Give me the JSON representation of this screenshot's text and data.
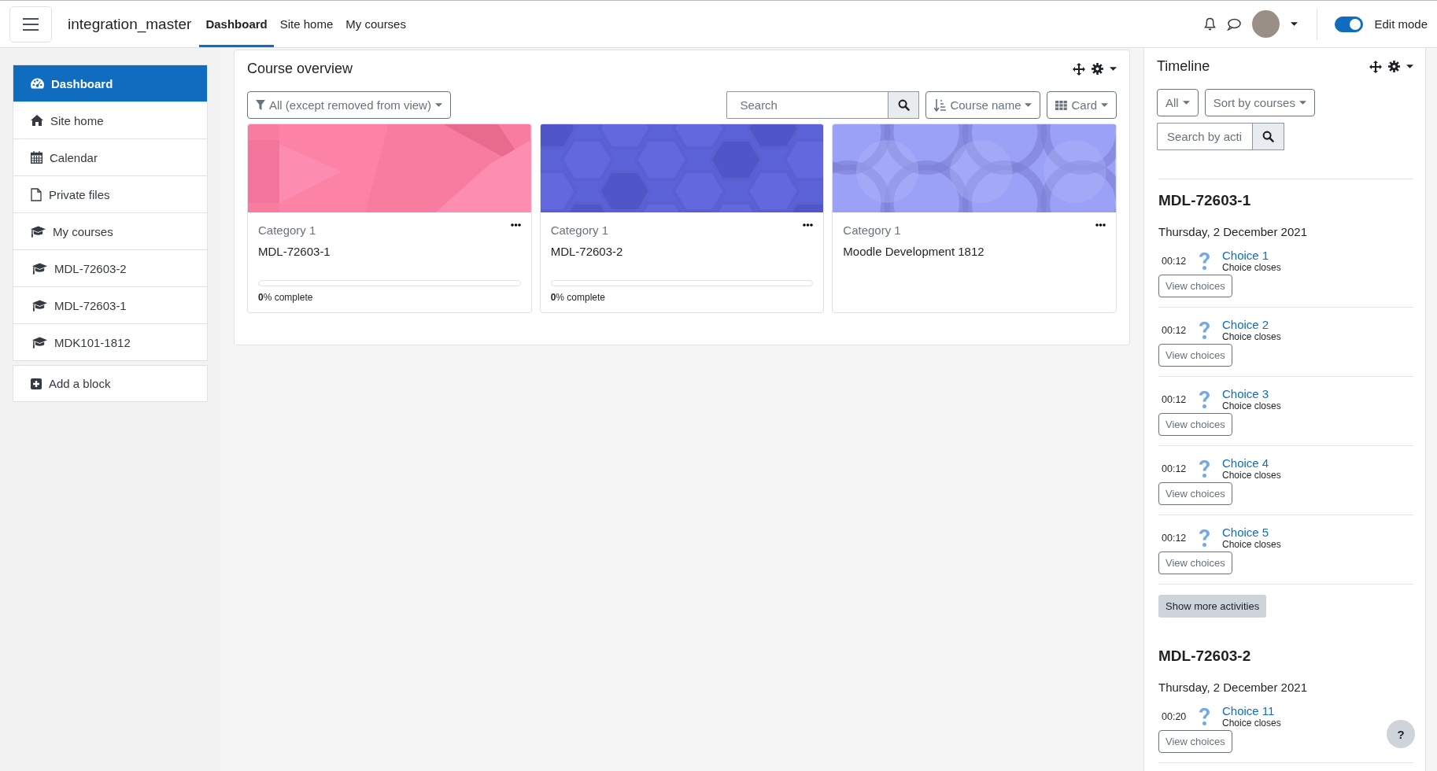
{
  "header": {
    "brand": "integration_master",
    "nav": [
      {
        "label": "Dashboard",
        "selected": true
      },
      {
        "label": "Site home",
        "selected": false
      },
      {
        "label": "My courses",
        "selected": false
      }
    ],
    "edit_mode": {
      "label": "Edit mode",
      "on": true
    }
  },
  "drawer": {
    "items": [
      {
        "kind": "dashboard",
        "label": "Dashboard",
        "selected": true
      },
      {
        "kind": "home",
        "label": "Site home",
        "selected": false
      },
      {
        "kind": "calendar",
        "label": "Calendar",
        "selected": false
      },
      {
        "kind": "file",
        "label": "Private files",
        "selected": false
      },
      {
        "kind": "courses",
        "label": "My courses",
        "selected": false,
        "children": [
          {
            "kind": "course",
            "label": "MDL-72603-2",
            "selected": false
          },
          {
            "kind": "course",
            "label": "MDL-72603-1",
            "selected": false
          },
          {
            "kind": "course",
            "label": "MDK101-1812",
            "selected": false
          }
        ]
      }
    ],
    "add_block": "Add a block"
  },
  "course_overview": {
    "title": "Course overview",
    "filter": "All (except removed from view)",
    "search_placeholder": "Search",
    "sort": "Course name",
    "view": "Card",
    "courses": [
      {
        "kind": "triangles",
        "color": "#f87ba0",
        "category": "Category 1",
        "name": "MDL-72603-1",
        "progress": {
          "level": 0,
          "label": "**0**% complete"
        }
      },
      {
        "kind": "hexagons",
        "color": "#5c63d8",
        "category": "Category 1",
        "name": "MDL-72603-2",
        "progress": {
          "level": 0,
          "label": "**0**% complete"
        }
      },
      {
        "kind": "circles",
        "color": "#9ba1f6",
        "category": "Category 1",
        "name": "Moodle Development 1812"
      }
    ]
  },
  "timeline": {
    "title": "Timeline",
    "filter": "All",
    "sort": "Sort by courses",
    "search_placeholder": "Search by acti",
    "groups": [
      {
        "course": "MDL-72603-1",
        "date": "Thursday, 2 December 2021",
        "events": [
          {
            "time": "00:12",
            "name": "Choice 1",
            "subtitle": "Choice closes",
            "action": "View choices"
          },
          {
            "time": "00:12",
            "name": "Choice 2",
            "subtitle": "Choice closes",
            "action": "View choices"
          },
          {
            "time": "00:12",
            "name": "Choice 3",
            "subtitle": "Choice closes",
            "action": "View choices"
          },
          {
            "time": "00:12",
            "name": "Choice 4",
            "subtitle": "Choice closes",
            "action": "View choices"
          },
          {
            "time": "00:12",
            "name": "Choice 5",
            "subtitle": "Choice closes",
            "action": "View choices"
          }
        ],
        "more": "Show more activities"
      },
      {
        "course": "MDL-72603-2",
        "date": "Thursday, 2 December 2021",
        "events": [
          {
            "time": "00:20",
            "name": "Choice 11",
            "subtitle": "Choice closes",
            "action": "View choices"
          }
        ]
      }
    ]
  },
  "help": "?"
}
